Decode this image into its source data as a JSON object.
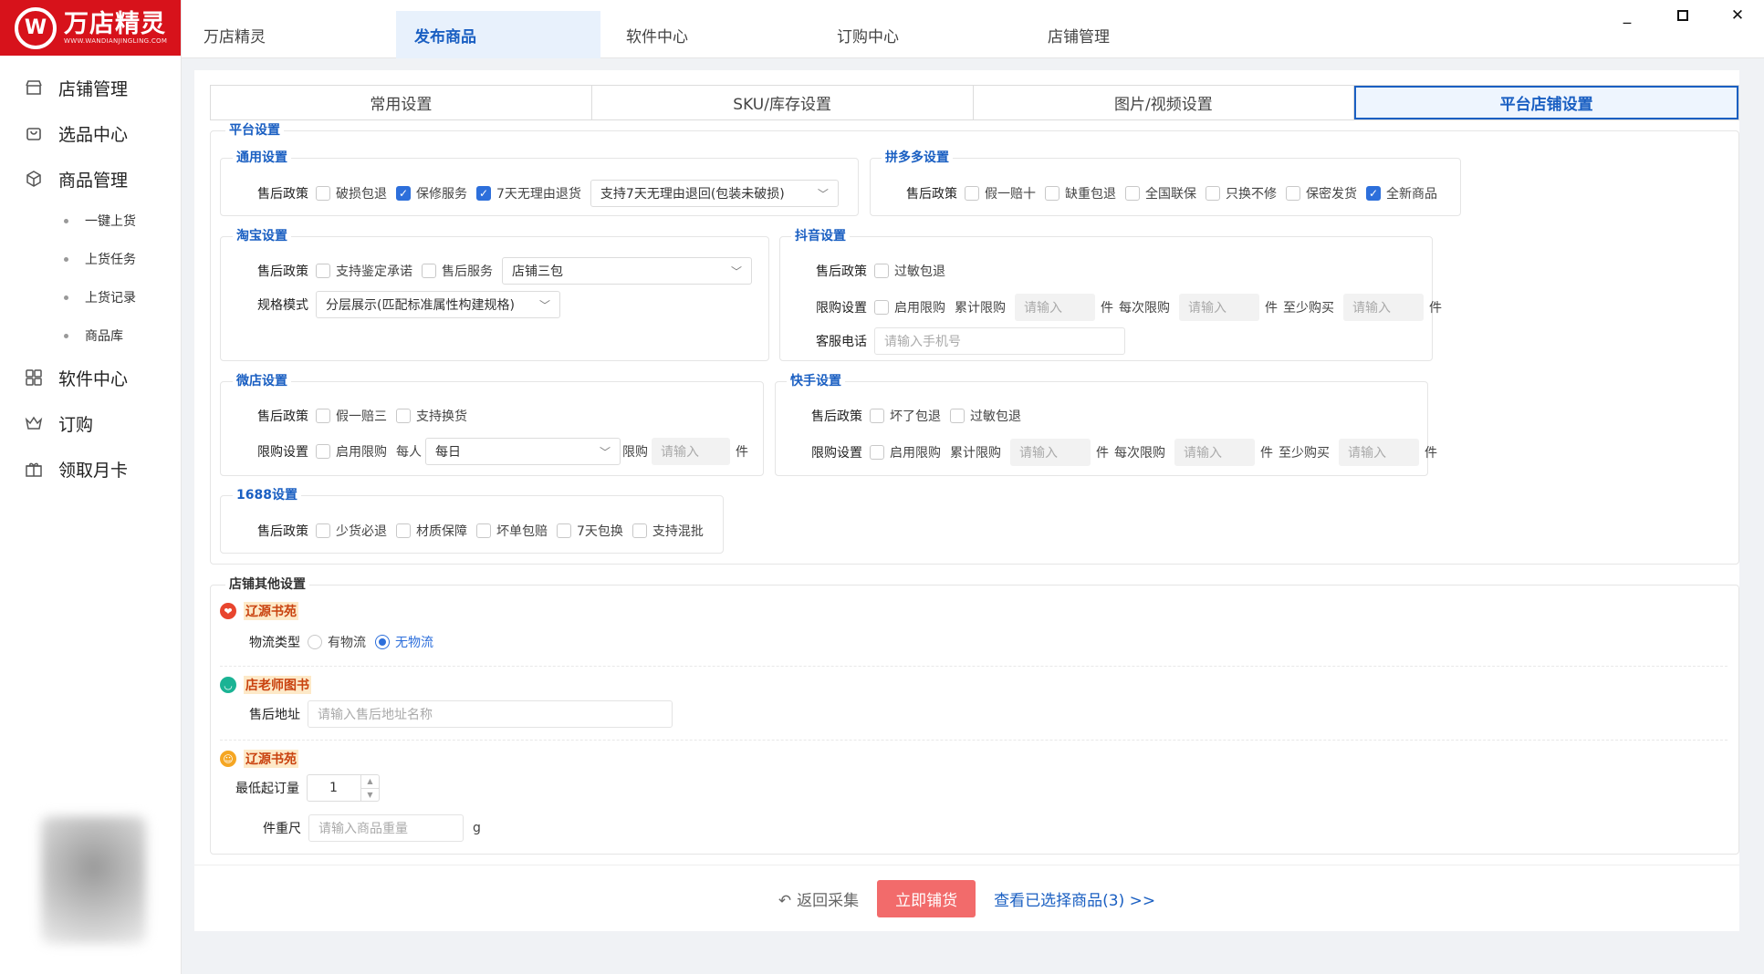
{
  "app": {
    "logo_title": "万店精灵",
    "logo_sub": "WWW.WANDIANJINGLING.COM",
    "logo_mark": "W"
  },
  "sidebar": {
    "items": [
      {
        "label": "店铺管理",
        "icon": "store-icon"
      },
      {
        "label": "选品中心",
        "icon": "bag-icon"
      },
      {
        "label": "商品管理",
        "icon": "box-icon"
      }
    ],
    "subitems": [
      "一键上货",
      "上货任务",
      "上货记录",
      "商品库"
    ],
    "items2": [
      {
        "label": "软件中心",
        "icon": "grid-icon"
      },
      {
        "label": "订购",
        "icon": "crown-icon"
      },
      {
        "label": "领取月卡",
        "icon": "gift-icon"
      }
    ]
  },
  "topnav": {
    "items": [
      "万店精灵",
      "发布商品",
      "软件中心",
      "订购中心",
      "店铺管理"
    ],
    "active": 1
  },
  "tabs": {
    "items": [
      "常用设置",
      "SKU/库存设置",
      "图片/视频设置",
      "平台店铺设置"
    ],
    "active": 3
  },
  "platform": {
    "legend": "平台设置",
    "general": {
      "legend": "通用设置",
      "label": "售后政策",
      "options": [
        {
          "text": "破损包退",
          "checked": false
        },
        {
          "text": "保修服务",
          "checked": true
        },
        {
          "text": "7天无理由退货",
          "checked": true
        }
      ],
      "select": "支持7天无理由退回(包装未破损)"
    },
    "pdd": {
      "legend": "拼多多设置",
      "label": "售后政策",
      "options": [
        {
          "text": "假一赔十",
          "checked": false
        },
        {
          "text": "缺重包退",
          "checked": false
        },
        {
          "text": "全国联保",
          "checked": false
        },
        {
          "text": "只换不修",
          "checked": false
        },
        {
          "text": "保密发货",
          "checked": false
        },
        {
          "text": "全新商品",
          "checked": true
        }
      ]
    },
    "taobao": {
      "legend": "淘宝设置",
      "label": "售后政策",
      "options": [
        {
          "text": "支持鉴定承诺",
          "checked": false
        },
        {
          "text": "售后服务",
          "checked": false
        }
      ],
      "select": "店铺三包",
      "spec_label": "规格模式",
      "spec_select": "分层展示(匹配标准属性构建规格)"
    },
    "douyin": {
      "legend": "抖音设置",
      "label": "售后政策",
      "options": [
        {
          "text": "过敏包退",
          "checked": false
        }
      ],
      "limit_label": "限购设置",
      "limit_enable": "启用限购",
      "total": "累计限购",
      "each": "每次限购",
      "min": "至少购买",
      "placeholder": "请输入",
      "unit": "件",
      "phone_label": "客服电话",
      "phone_placeholder": "请输入手机号"
    },
    "weidian": {
      "legend": "微店设置",
      "label": "售后政策",
      "options": [
        {
          "text": "假一赔三",
          "checked": false
        },
        {
          "text": "支持换货",
          "checked": false
        }
      ],
      "limit_label": "限购设置",
      "limit_enable": "启用限购",
      "per_person": "每人",
      "period": "每日",
      "limit": "限购",
      "placeholder": "请输入",
      "unit": "件"
    },
    "kuaishou": {
      "legend": "快手设置",
      "label": "售后政策",
      "options": [
        {
          "text": "坏了包退",
          "checked": false
        },
        {
          "text": "过敏包退",
          "checked": false
        }
      ],
      "limit_label": "限购设置",
      "limit_enable": "启用限购",
      "total": "累计限购",
      "each": "每次限购",
      "min": "至少购买",
      "placeholder": "请输入",
      "unit": "件"
    },
    "s1688": {
      "legend": "1688设置",
      "label": "售后政策",
      "options": [
        {
          "text": "少货必退",
          "checked": false
        },
        {
          "text": "材质保障",
          "checked": false
        },
        {
          "text": "坏单包赔",
          "checked": false
        },
        {
          "text": "7天包换",
          "checked": false
        },
        {
          "text": "支持混批",
          "checked": false
        }
      ]
    }
  },
  "other": {
    "legend": "店铺其他设置",
    "shop1": {
      "name": "辽源书苑",
      "label": "物流类型",
      "opt1": "有物流",
      "opt2": "无物流",
      "color": "#e8452e"
    },
    "shop2": {
      "name": "店老师图书",
      "label": "售后地址",
      "placeholder": "请输入售后地址名称",
      "color": "#1ab394"
    },
    "shop3": {
      "name": "辽源书苑",
      "min_label": "最低起订量",
      "min_value": "1",
      "weight_label": "件重尺",
      "weight_placeholder": "请输入商品重量",
      "weight_unit": "g",
      "color": "#f5a623"
    }
  },
  "footer": {
    "back": "返回采集",
    "submit": "立即铺货",
    "view": "查看已选择商品(3) >>"
  },
  "colors": {
    "brand": "#d7121b",
    "accent": "#1a5fc2",
    "submit": "#f26b6b"
  }
}
